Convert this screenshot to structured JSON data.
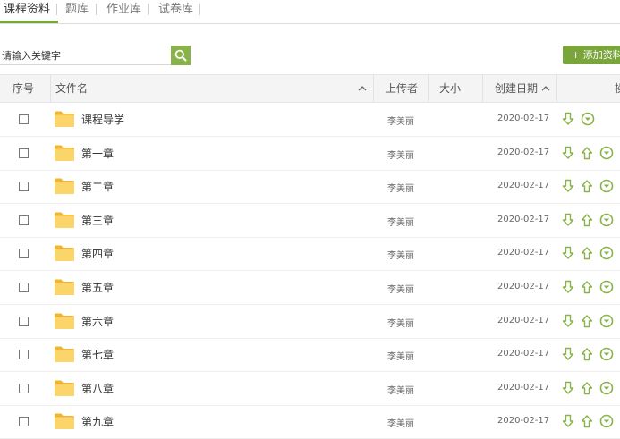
{
  "tabs": [
    {
      "label": "课程资料",
      "active": true
    },
    {
      "label": "题库",
      "active": false
    },
    {
      "label": "作业库",
      "active": false
    },
    {
      "label": "试卷库",
      "active": false
    }
  ],
  "search": {
    "placeholder": "请输入关键字"
  },
  "add_button_label": "+ 添加资料",
  "table": {
    "headers": {
      "index": "序号",
      "filename": "文件名",
      "uploader": "上传者",
      "size": "大小",
      "created": "创建日期",
      "actions": "操作"
    },
    "rows": [
      {
        "name": "课程导学",
        "uploader": "李美丽",
        "size": "",
        "date": "2020-02-17"
      },
      {
        "name": "第一章",
        "uploader": "李美丽",
        "size": "",
        "date": "2020-02-17"
      },
      {
        "name": "第二章",
        "uploader": "李美丽",
        "size": "",
        "date": "2020-02-17"
      },
      {
        "name": "第三章",
        "uploader": "李美丽",
        "size": "",
        "date": "2020-02-17"
      },
      {
        "name": "第四章",
        "uploader": "李美丽",
        "size": "",
        "date": "2020-02-17"
      },
      {
        "name": "第五章",
        "uploader": "李美丽",
        "size": "",
        "date": "2020-02-17"
      },
      {
        "name": "第六章",
        "uploader": "李美丽",
        "size": "",
        "date": "2020-02-17"
      },
      {
        "name": "第七章",
        "uploader": "李美丽",
        "size": "",
        "date": "2020-02-17"
      },
      {
        "name": "第八章",
        "uploader": "李美丽",
        "size": "",
        "date": "2020-02-17"
      },
      {
        "name": "第九章",
        "uploader": "李美丽",
        "size": "",
        "date": "2020-02-17"
      }
    ]
  },
  "icons": {
    "search": "search-icon",
    "folder": "folder-icon",
    "move_down": "arrow-down-icon",
    "move_up": "arrow-up-icon",
    "more": "chevron-circle-down-icon",
    "sort": "sort-chevron-up-icon"
  },
  "colors": {
    "accent": "#7aa53a",
    "folder": "#f9c94a",
    "header_bg": "#f4f4f4"
  }
}
